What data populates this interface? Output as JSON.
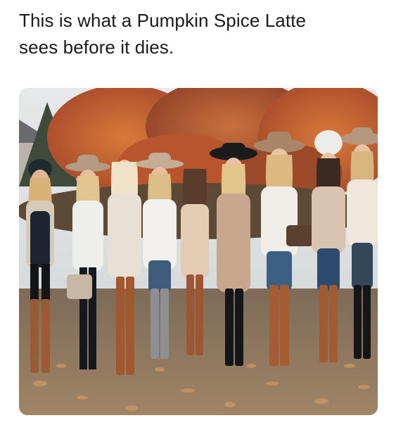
{
  "post": {
    "caption_line1": "This is what a Pumpkin Spice Latte",
    "caption_line2": "sees before it dies."
  },
  "photo": {
    "subject": "group-of-women-in-autumn-outfits",
    "colors": {
      "sky": "#dfe2e4",
      "foliage_orange": "#c8642e",
      "foliage_red": "#a8432a",
      "ground": "#8a7560",
      "leaves": "#b58a58",
      "boots": "#9a5a32"
    }
  }
}
